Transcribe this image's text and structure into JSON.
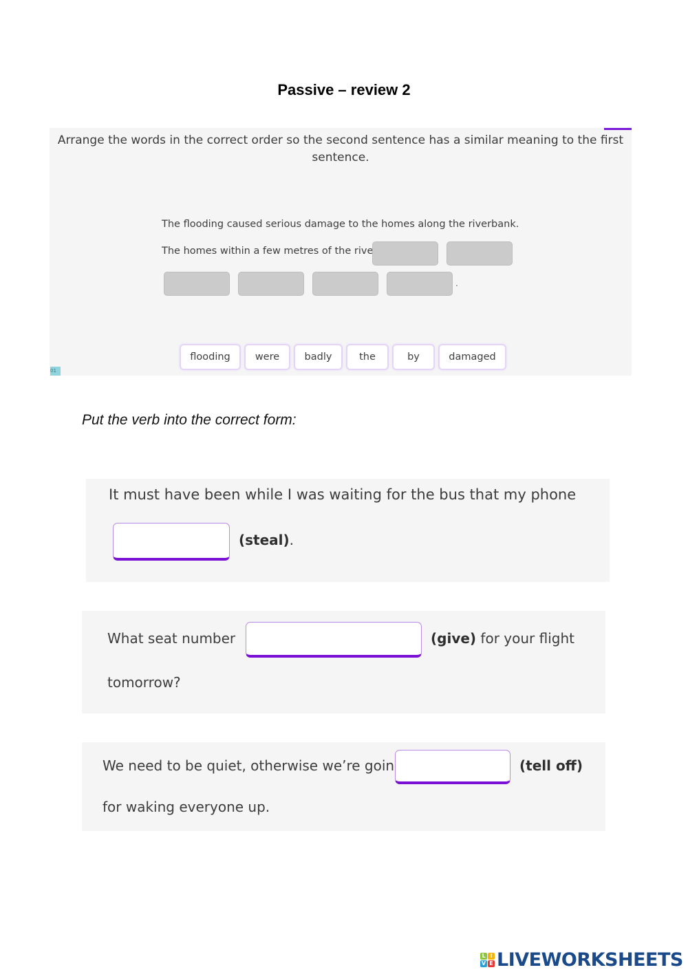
{
  "title": "Passive – review 2",
  "exercise1": {
    "instructions": "Arrange the words in the correct order so the second sentence has a similar meaning to the first sentence.",
    "sentence_original": "The flooding caused serious damage to the homes along the riverbank.",
    "sentence_prompt": "The homes within a few metres of the river",
    "slots_count": 6,
    "sentence_end": ".",
    "word_bank": [
      "flooding",
      "were",
      "badly",
      "the",
      "by",
      "damaged"
    ],
    "corner_badge": "01"
  },
  "exercise2": {
    "heading": "Put the verb into the correct form:",
    "questions": [
      {
        "before": "It must have been while I was waiting for the bus that my phone",
        "answer": "",
        "verb": "(steal)",
        "after": "."
      },
      {
        "before": "What seat number",
        "answer": "",
        "verb": "(give)",
        "after": " for your flight",
        "line2": "tomorrow?"
      },
      {
        "before": "We need to be quiet, otherwise we’re going",
        "answer": "",
        "verb": "(tell off)",
        "line2": "for waking everyone up."
      }
    ]
  },
  "colors": {
    "accent_purple": "#7a10d6",
    "panel_bg": "#f5f5f5",
    "logo_blue": "#1a4a8a"
  },
  "logo": {
    "letters": [
      "L",
      "I",
      "V",
      "E"
    ],
    "text": "LIVEWORKSHEETS"
  }
}
